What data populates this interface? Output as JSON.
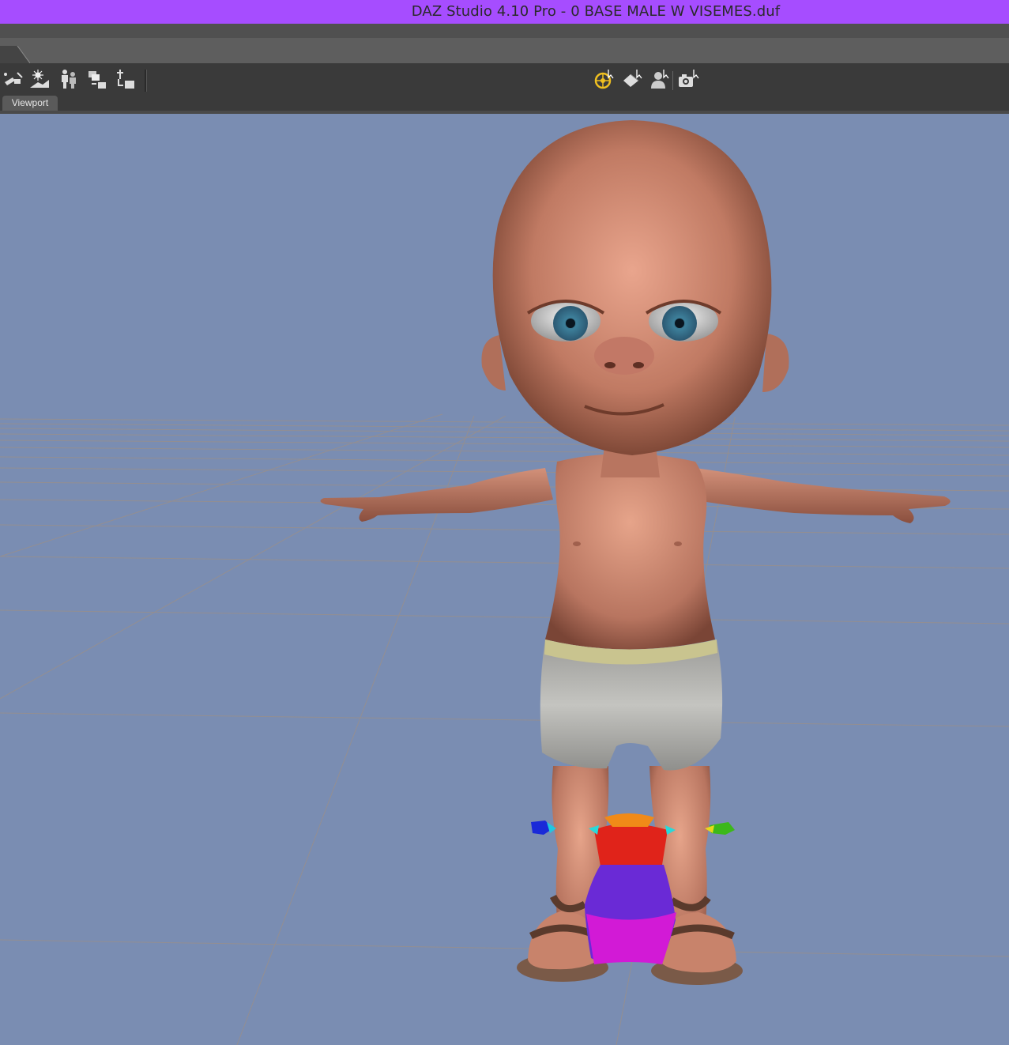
{
  "window": {
    "title": "DAZ Studio 4.10 Pro - 0 BASE MALE W VISEMES.duf"
  },
  "toolbar": {
    "left_tools": [
      "new-light-icon",
      "environment-icon",
      "figure-pose-icon",
      "merge-scene-icon",
      "import-icon"
    ],
    "center_tools": [
      "universal-tool-icon",
      "surface-selection-icon",
      "figure-select-icon",
      "camera-render-icon"
    ]
  },
  "viewport": {
    "tab_label": "Viewport",
    "background_color": "#7a8db2",
    "grid_color": "#9a8f8a",
    "scene": "baby-figure-t-pose"
  },
  "colors": {
    "title_bar": "#a64dff",
    "toolbar": "#3a3a3a",
    "active_tool": "#f0c020"
  }
}
